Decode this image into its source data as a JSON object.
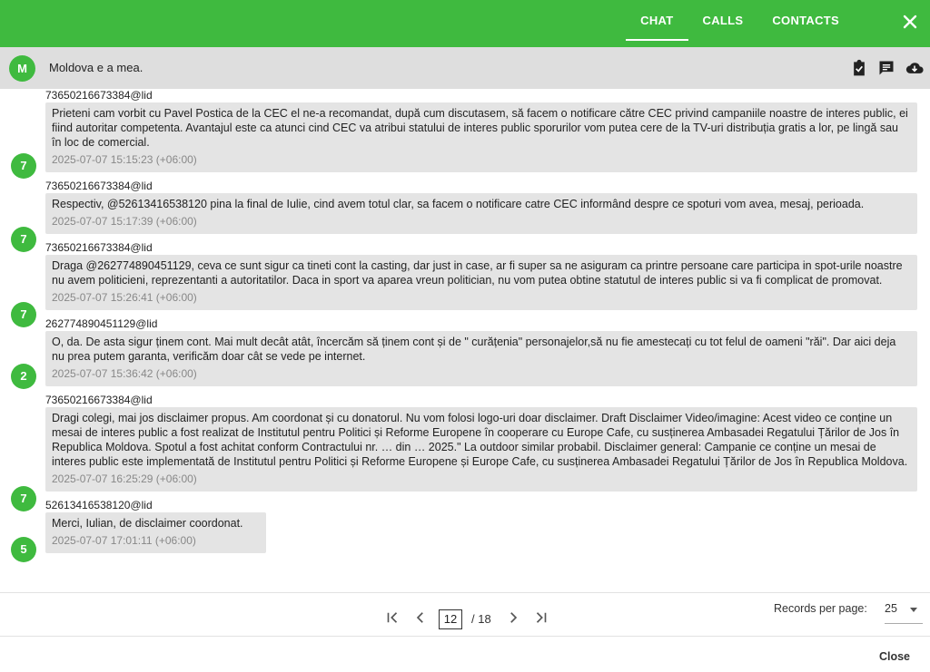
{
  "tabs": [
    {
      "label": "CHAT",
      "active": true
    },
    {
      "label": "CALLS",
      "active": false
    },
    {
      "label": "CONTACTS",
      "active": false
    }
  ],
  "close_icon": "close-icon",
  "conversation": {
    "avatar": "M",
    "title": "Moldova e a mea.",
    "icons": [
      "clipboard-check-icon",
      "message-icon",
      "cloud-download-icon"
    ]
  },
  "messages": [
    {
      "sender": "73650216673384@lid",
      "avatar": "7",
      "text": "Prieteni cam vorbit cu Pavel Postica de la CEC el ne-a recomandat, după cum discutasem, să facem o notificare către CEC privind campaniile noastre de interes public, ei fiind autoritar competenta. Avantajul este ca atunci cind CEC va atribui statului de interes public sporurilor vom putea cere de la TV-uri distribuția gratis a lor, pe lingă sau în loc de comercial.",
      "time": "2025-07-07 15:15:23 (+06:00)"
    },
    {
      "sender": "73650216673384@lid",
      "avatar": "7",
      "text": "Respectiv, @52613416538120 pina la final de Iulie, cind avem totul clar, sa facem o notificare catre CEC informând despre ce spoturi vom avea, mesaj, perioada.",
      "time": "2025-07-07 15:17:39 (+06:00)"
    },
    {
      "sender": "73650216673384@lid",
      "avatar": "7",
      "text": "Draga @262774890451129, ceva ce sunt sigur ca tineti cont la casting, dar just in case, ar fi super sa ne asiguram ca printre persoane care participa in spot-urile noastre nu avem politicieni, reprezentanti a autoritatilor. Daca in sport va aparea vreun politician, nu vom putea obtine statutul de interes public si va fi complicat de promovat.",
      "time": "2025-07-07 15:26:41 (+06:00)"
    },
    {
      "sender": "262774890451129@lid",
      "avatar": "2",
      "text": "O, da. De asta sigur ținem cont. Mai mult decât atât, încercăm să ținem cont și de \" curățenia\" personajelor,să nu fie amestecați cu tot felul de oameni \"răi\". Dar aici deja nu prea putem garanta, verificăm doar cât se vede pe internet.",
      "time": "2025-07-07 15:36:42 (+06:00)"
    },
    {
      "sender": "73650216673384@lid",
      "avatar": "7",
      "text": "Dragi colegi, mai jos disclaimer propus. Am coordonat și cu donatorul. Nu vom folosi logo-uri doar disclaimer. Draft Disclaimer Video/imagine: Acest video ce conține un mesai de interes public a fost realizat de Institutul pentru Politici și Reforme Europene în cooperare cu Europe Cafe, cu susținerea Ambasadei Regatului Țărilor de Jos în Republica Moldova. Spotul a fost achitat conform Contractului nr. … din … 2025.\" La outdoor similar probabil. Disclaimer general: Campanie ce conține un mesai de interes public este implementată de Institutul pentru Politici și Reforme Europene și Europe Cafe, cu susținerea Ambasadei Regatului Țărilor de Jos în Republica Moldova.",
      "time": "2025-07-07 16:25:29 (+06:00)"
    },
    {
      "sender": "52613416538120@lid",
      "avatar": "5",
      "text": "Merci, Iulian, de disclaimer coordonat.",
      "time": "2025-07-07 17:01:11 (+06:00)"
    }
  ],
  "pager": {
    "first_icon": "first-page-icon",
    "prev_icon": "chevron-left-icon",
    "current_page": "12",
    "total": "/ 18",
    "next_icon": "chevron-right-icon",
    "last_icon": "last-page-icon",
    "records_label": "Records per page:",
    "records_value": "25"
  },
  "footer": {
    "close_label": "Close"
  }
}
